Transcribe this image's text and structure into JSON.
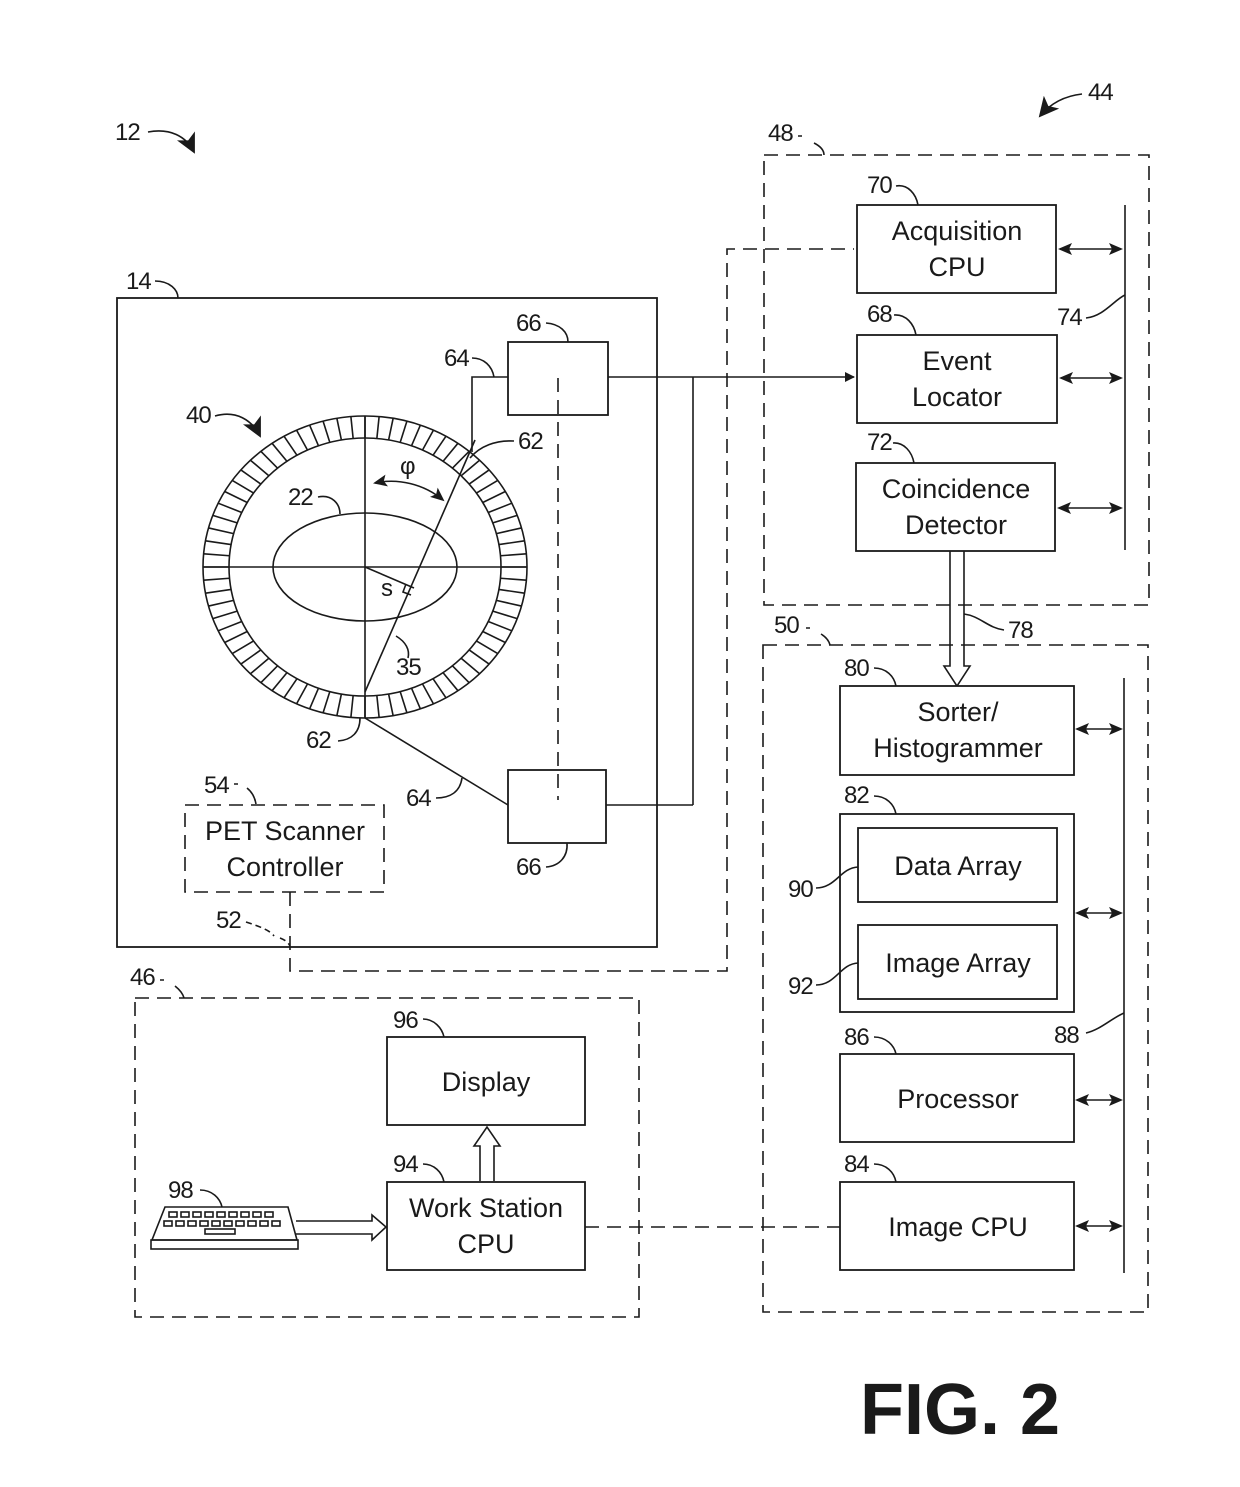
{
  "figure": {
    "label": "FIG. 2",
    "system_ref": "12",
    "console_ref": "44",
    "scanner": {
      "ref": "14",
      "ring_ref": "40",
      "patient_ref": "22",
      "line_ref": "35",
      "detector_refs": [
        "62",
        "62"
      ],
      "angle_symbol": "φ",
      "offset_symbol": "s",
      "line_refs": [
        "64",
        "64"
      ],
      "processor_refs": [
        "66",
        "66"
      ],
      "controller": {
        "ref": "54",
        "line1": "PET Scanner",
        "line2": "Controller"
      },
      "link_ref": "52"
    },
    "acquisition_system": {
      "ref": "48",
      "bus_ref": "74",
      "blocks": [
        {
          "ref": "70",
          "line1": "Acquisition",
          "line2": "CPU"
        },
        {
          "ref": "68",
          "line1": "Event",
          "line2": "Locator"
        },
        {
          "ref": "72",
          "line1": "Coincidence",
          "line2": "Detector"
        }
      ]
    },
    "link_78": "78",
    "image_reconstructor": {
      "ref": "50",
      "bus_ref": "88",
      "sorter": {
        "ref": "80",
        "line1": "Sorter/",
        "line2": "Histogrammer"
      },
      "memory": {
        "ref": "82",
        "data_array": {
          "ref": "90",
          "label": "Data Array"
        },
        "image_array": {
          "ref": "92",
          "label": "Image Array"
        }
      },
      "processor": {
        "ref": "86",
        "label": "Processor"
      },
      "image_cpu": {
        "ref": "84",
        "label": "Image CPU"
      }
    },
    "workstation": {
      "ref": "46",
      "display": {
        "ref": "96",
        "label": "Display"
      },
      "cpu": {
        "ref": "94",
        "line1": "Work Station",
        "line2": "CPU"
      },
      "keyboard": {
        "ref": "98"
      }
    }
  }
}
